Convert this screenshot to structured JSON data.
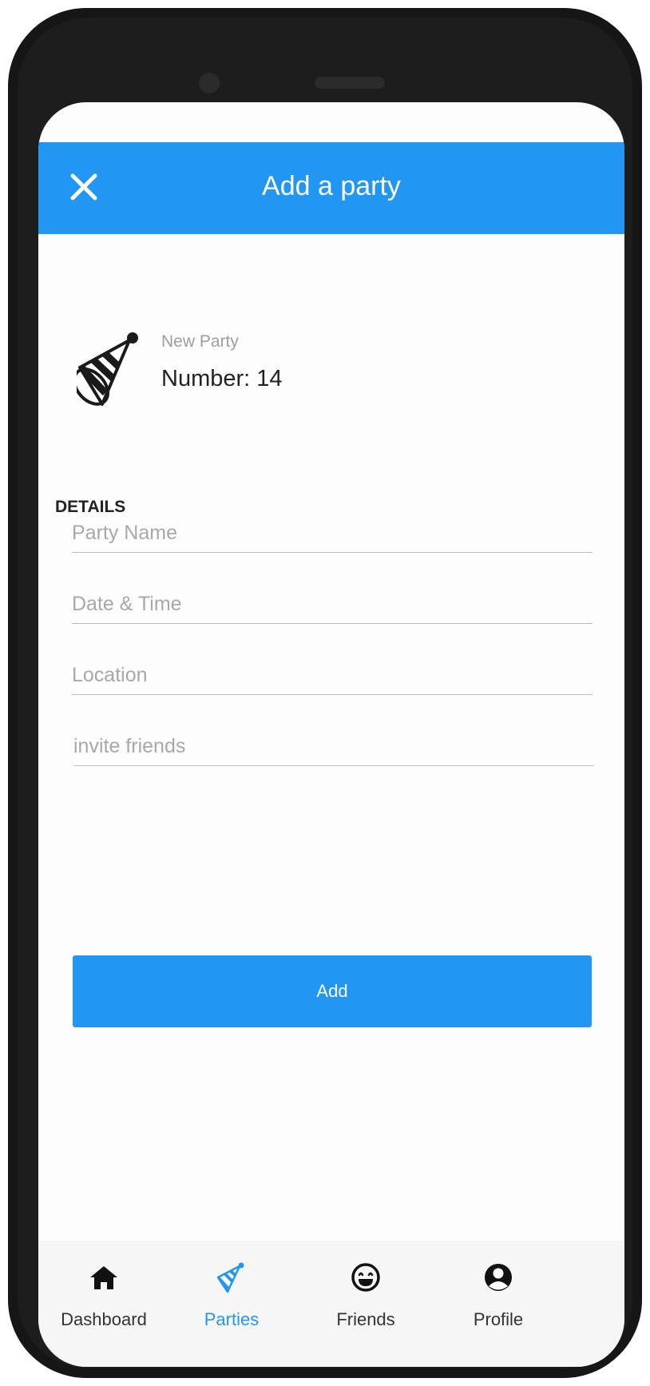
{
  "header": {
    "title": "Add a party"
  },
  "party_card": {
    "subtitle": "New Party",
    "number": "Number: 14"
  },
  "details": {
    "title": "DETAILS",
    "fields": [
      {
        "placeholder": "Party Name",
        "value": ""
      },
      {
        "placeholder": "Date & Time",
        "value": ""
      },
      {
        "placeholder": "Location",
        "value": ""
      },
      {
        "placeholder": "invite friends",
        "value": ""
      }
    ]
  },
  "add_button": {
    "label": "Add"
  },
  "bottom_nav": {
    "items": [
      {
        "label": "Dashboard",
        "icon": "home-icon"
      },
      {
        "label": "Parties",
        "icon": "party-hat-icon",
        "active": true
      },
      {
        "label": "Friends",
        "icon": "smiley-icon"
      },
      {
        "label": "Profile",
        "icon": "user-circle-icon"
      }
    ]
  },
  "colors": {
    "accent": "#2196f3",
    "background": "#fdfdfd",
    "nav_background": "#f6f6f6"
  }
}
